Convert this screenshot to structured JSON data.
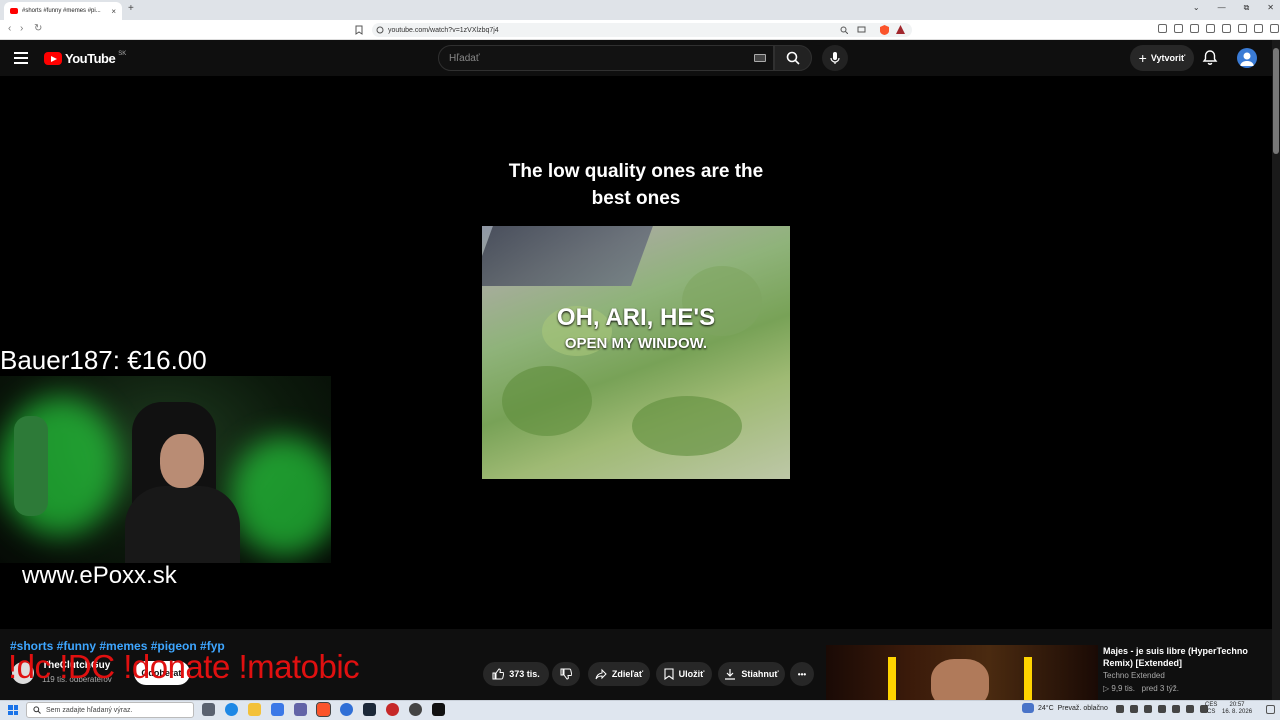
{
  "browser": {
    "tab_title": "#shorts #funny #memes #pi...",
    "tab_close": "×",
    "new_tab": "+",
    "url": "youtube.com/watch?v=1zVXlzbq7j4",
    "nav": {
      "back": "‹",
      "forward": "›",
      "reload": "↻"
    },
    "window_controls": {
      "chevron": "⌄",
      "minimize": "—",
      "restore": "⧉",
      "close": "✕"
    }
  },
  "youtube_header": {
    "logo_text": "YouTube",
    "country_code": "SK",
    "search_placeholder": "Hľadať",
    "create_label": "Vytvoriť",
    "create_icon": "+"
  },
  "video": {
    "caption_line1": "The low quality ones are the",
    "caption_line2": "best ones",
    "subtitle_line1": "OH, ARI, HE'S",
    "subtitle_line2": "OPEN MY WINDOW."
  },
  "stream_overlay": {
    "donation": "Bauer187: €16.00",
    "website": "www.ePoxx.sk",
    "commands": "!dc !DC !donate !matobic"
  },
  "video_info": {
    "hashtags": "#shorts #funny #memes #pigeon #fyp",
    "channel_name": "TheClutchGuy",
    "subscribers": "119 tis. odberateľov",
    "subscribe_label": "Odoberať"
  },
  "actions": {
    "likes": "373 tis.",
    "share": "Zdieľať",
    "save": "Uložiť",
    "download": "Stiahnuť",
    "more": "•••"
  },
  "recommendation": {
    "title": "Majes - je suis libre (HyperTechno Remix) [Extended]",
    "channel": "Techno Extended",
    "views": "▷ 9,9 tis.",
    "age": "pred 3 týž."
  },
  "taskbar": {
    "search_placeholder": "Sem zadajte hľadaný výraz.",
    "weather_temp": "24°C",
    "weather_text": "Prevaž. oblačno",
    "lang_1": "CES",
    "lang_2": "CS",
    "time": "20:57",
    "date": "16. 8. 2026"
  },
  "colors": {
    "youtube_red": "#ff0000",
    "link_blue": "#3ea6ff",
    "overlay_red": "#e01010",
    "background": "#0f0f0f"
  }
}
